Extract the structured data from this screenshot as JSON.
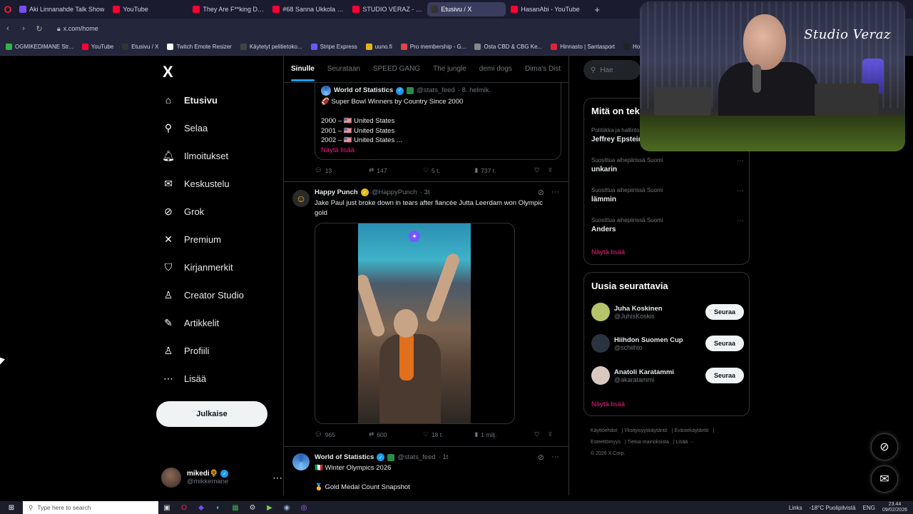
{
  "browser": {
    "tabs": [
      {
        "label": "Aki Linnanahde Talk Show",
        "color": "#7a4df0",
        "active": false
      },
      {
        "label": "YouTube",
        "color": "#ff0033",
        "active": false
      },
      {
        "label": "They Are F**king Desperat",
        "color": "#ff0033",
        "active": false
      },
      {
        "label": "#68 Sanna Ukkola - YouTu",
        "color": "#ff0033",
        "active": false
      },
      {
        "label": "STUDIO VERAZ - YouT",
        "color": "#ff0033",
        "active": false
      },
      {
        "label": "Etusivu / X",
        "color": "#333",
        "active": true
      },
      {
        "label": "HasanAbi - YouTube",
        "color": "#ff0033",
        "active": false
      }
    ],
    "new_tab": "+",
    "url": "x.com/home",
    "bookmarks": [
      {
        "label": "OGMIKEDIMANE Str...",
        "color": "#32b34a"
      },
      {
        "label": "YouTube",
        "color": "#ff0033"
      },
      {
        "label": "Etusivu / X",
        "color": "#333"
      },
      {
        "label": "Twitch Emote Resizer",
        "color": "#ffffff"
      },
      {
        "label": "Käytetyt pelitietoko...",
        "color": "#444"
      },
      {
        "label": "Stripe Express",
        "color": "#635bff"
      },
      {
        "label": "uuno.fi",
        "color": "#e2b719"
      },
      {
        "label": "Pro membership - G...",
        "color": "#e04545"
      },
      {
        "label": "Osta CBD & CBG Ke...",
        "color": "#888"
      },
      {
        "label": "Hinnasto | Santasport",
        "color": "#e0223a"
      },
      {
        "label": "Hopeinen co",
        "color": "#222"
      }
    ]
  },
  "nav": {
    "logo": "X",
    "items": [
      {
        "label": "Etusivu",
        "icon": "home-icon",
        "glyph": "⌂",
        "active": true
      },
      {
        "label": "Selaa",
        "icon": "search-icon",
        "glyph": "⚲",
        "active": false
      },
      {
        "label": "Ilmoitukset",
        "icon": "bell-icon",
        "glyph": "🔔︎",
        "active": false
      },
      {
        "label": "Keskustelu",
        "icon": "mail-icon",
        "glyph": "✉",
        "active": false
      },
      {
        "label": "Grok",
        "icon": "grok-icon",
        "glyph": "⊘",
        "active": false
      },
      {
        "label": "Premium",
        "icon": "x-premium-icon",
        "glyph": "✕",
        "active": false
      },
      {
        "label": "Kirjanmerkit",
        "icon": "bookmark-icon",
        "glyph": "⛉",
        "active": false
      },
      {
        "label": "Creator Studio",
        "icon": "creator-studio-icon",
        "glyph": "♙",
        "active": false
      },
      {
        "label": "Artikkelit",
        "icon": "articles-icon",
        "glyph": "✎",
        "active": false
      },
      {
        "label": "Profiili",
        "icon": "profile-icon",
        "glyph": "♙",
        "active": false
      },
      {
        "label": "Lisää",
        "icon": "more-circle-icon",
        "glyph": "⋯",
        "active": false
      }
    ],
    "post_button": "Julkaise",
    "account": {
      "name": "mikedi🌻",
      "handle": "@mikkemane",
      "more": "⋯"
    }
  },
  "timeline": {
    "tabs": [
      "Sinulle",
      "Seurataan",
      "SPEED GANG",
      "The jungle",
      "demi dogs",
      "Dima's Dist"
    ],
    "quoted": {
      "name": "World of Statistics",
      "handle": "@stats_feed",
      "time": "· 8. helmik.",
      "lines": [
        "🏈 Super Bowl Winners by Country Since 2000",
        "",
        "2000 – 🇺🇸 United States",
        "2001 – 🇺🇸 United States",
        "2002 – 🇺🇸 United States ..."
      ],
      "show_more": "Näytä lisää"
    },
    "quoted_actions": {
      "replies": "13",
      "reposts": "147",
      "likes": "5 t.",
      "views": "737 t."
    },
    "post2": {
      "name": "Happy Punch",
      "handle": "@HappyPunch",
      "time": "· 3t",
      "text": "Jake Paul just broke down in tears after fiancée Jutta Leerdam won Olympic gold",
      "actions": {
        "replies": "965",
        "reposts": "600",
        "likes": "18 t.",
        "views": "1 milj."
      }
    },
    "post3": {
      "name": "World of Statistics",
      "handle": "@stats_feed",
      "time": "· 1t",
      "line1": "🇮🇹 Winter Olympics 2026",
      "line2": "🥇 Gold Medal Count Snapshot"
    }
  },
  "sidebar": {
    "search_placeholder": "Hae",
    "trends_title": "Mitä on tekeillä",
    "trends": [
      {
        "meta": "Politiikka ja hallinto",
        "topic": "Jeffrey Epstein"
      },
      {
        "meta": "Suosittua aihepiirissä Suomi",
        "topic": "unkarin"
      },
      {
        "meta": "Suosittua aihepiirissä Suomi",
        "topic": "lämmin"
      },
      {
        "meta": "Suosittua aihepiirissä Suomi",
        "topic": "Anders"
      }
    ],
    "trends_show_more": "Näytä lisää",
    "follow_title": "Uusia seurattavia",
    "follow": [
      {
        "name": "Juha Koskinen",
        "handle": "@JuhisKoskis",
        "button": "Seuraa",
        "color": "#b5c46a"
      },
      {
        "name": "Hiihdon Suomen Cup",
        "handle": "@schiihto",
        "button": "Seuraa",
        "color": "#2a3440"
      },
      {
        "name": "Anatoli Karatammi",
        "handle": "@akaratammi",
        "button": "Seuraa",
        "color": "#d8c8c0"
      }
    ],
    "follow_show_more": "Näytä lisää",
    "footer": [
      "Käyttöehdot",
      "Yksityisyyskäytäntö",
      "Evästekäytäntö",
      "Esteettömyys",
      "Tietoa mainoksista",
      "Lisää ···",
      "© 2026 X Corp."
    ]
  },
  "webcam": {
    "overlay_text": "Studio Veraz"
  },
  "taskbar": {
    "search_placeholder": "Type here to search",
    "links": "Links",
    "weather": "-18°C  Puolipilvistä",
    "lang": "ENG",
    "time": "23.44",
    "date": "09/02/2026"
  }
}
